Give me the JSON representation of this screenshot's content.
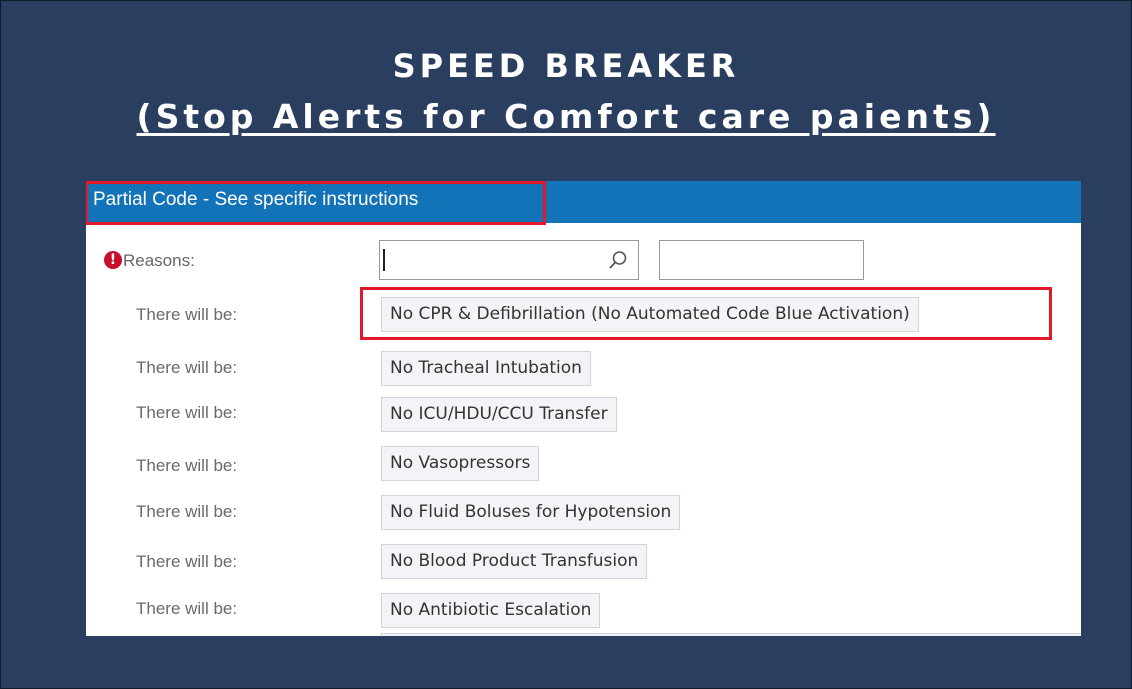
{
  "slide": {
    "title_line1": "SPEED BREAKER",
    "title_line2": "(Stop Alerts for Comfort care paients)"
  },
  "panel": {
    "header": "Partial Code - See specific instructions",
    "reasons_label": "Reasons:",
    "search_value": "",
    "options": [
      {
        "label": "There will be:",
        "value": "No CPR & Defibrillation (No Automated Code Blue Activation)"
      },
      {
        "label": "There will be:",
        "value": "No Tracheal Intubation"
      },
      {
        "label": "There will be:",
        "value": "No ICU/HDU/CCU Transfer"
      },
      {
        "label": "There will be:",
        "value": "No Vasopressors"
      },
      {
        "label": "There will be:",
        "value": "No Fluid Boluses for Hypotension"
      },
      {
        "label": "There will be:",
        "value": "No Blood Product Transfusion"
      },
      {
        "label": "There will be:",
        "value": "No Antibiotic Escalation"
      }
    ]
  },
  "colors": {
    "slide_background": "#2a3f5f",
    "header_blue": "#1373b8",
    "highlight_red": "#e0192b",
    "required_red": "#c8102e"
  },
  "icons": {
    "required": "exclamation-circle-icon",
    "search": "search-icon"
  }
}
